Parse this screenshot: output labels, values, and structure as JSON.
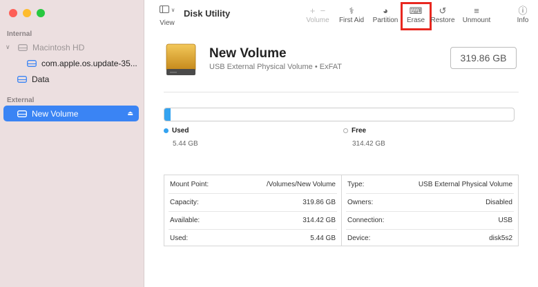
{
  "colors": {
    "accent": "#3a84f4",
    "used": "#34a3f0",
    "highlight": "#e8271f",
    "close": "#fe5f57",
    "minimize": "#febc2e",
    "zoom": "#28c840"
  },
  "sidebar": {
    "internal_label": "Internal",
    "external_label": "External",
    "items": [
      {
        "label": "Macintosh HD",
        "icon": "disk-icon",
        "state": "muted"
      },
      {
        "label": "com.apple.os.update-35...",
        "icon": "volume-icon"
      },
      {
        "label": "Data",
        "icon": "volume-icon"
      },
      {
        "label": "New Volume",
        "icon": "external-disk-icon",
        "state": "selected"
      }
    ]
  },
  "toolbar": {
    "view_label": "View",
    "title": "Disk Utility",
    "volume_label": "Volume",
    "first_aid_label": "First Aid",
    "partition_label": "Partition",
    "erase_label": "Erase",
    "restore_label": "Restore",
    "unmount_label": "Unmount",
    "info_label": "Info"
  },
  "volume": {
    "name": "New Volume",
    "subtitle": "USB External Physical Volume • ExFAT",
    "size": "319.86 GB",
    "used_fraction": 0.017
  },
  "legend": {
    "used_label": "Used",
    "used_value": "5.44 GB",
    "free_label": "Free",
    "free_value": "314.42 GB"
  },
  "info": {
    "left": [
      {
        "key": "Mount Point:",
        "value": "/Volumes/New Volume"
      },
      {
        "key": "Capacity:",
        "value": "319.86 GB"
      },
      {
        "key": "Available:",
        "value": "314.42 GB"
      },
      {
        "key": "Used:",
        "value": "5.44 GB"
      }
    ],
    "right": [
      {
        "key": "Type:",
        "value": "USB External Physical Volume"
      },
      {
        "key": "Owners:",
        "value": "Disabled"
      },
      {
        "key": "Connection:",
        "value": "USB"
      },
      {
        "key": "Device:",
        "value": "disk5s2"
      }
    ]
  }
}
